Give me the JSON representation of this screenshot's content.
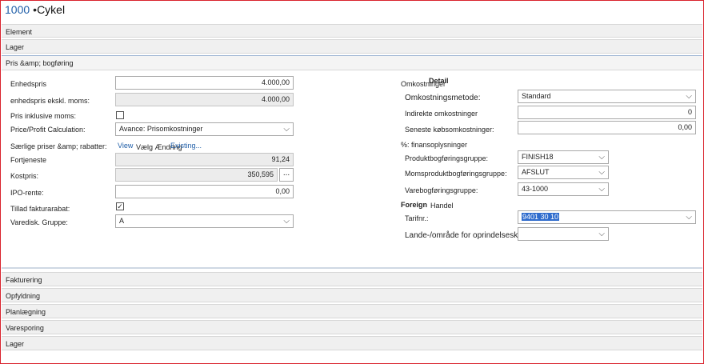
{
  "header": {
    "number": "1000",
    "separator": "•",
    "name": "Cykel"
  },
  "tabs": {
    "element": "Element",
    "lager_top": "Lager",
    "pris": "Pris &amp; bogføring",
    "fakturering": "Fakturering",
    "opfyldning": "Opfyldning",
    "planlaegning": "Planlægning",
    "varesporing": "Varesporing",
    "lager_bottom": "Lager"
  },
  "left": {
    "enhedspris": {
      "label": "Enhedspris",
      "value": "4.000,00"
    },
    "enhedspris_ekskl": {
      "label": "enhedspris ekskl. moms:",
      "value": "4.000,00"
    },
    "pris_inkl": {
      "label": "Pris inklusive moms:",
      "checked": ""
    },
    "price_profit": {
      "label": "Price/Profit Calculation:",
      "value": "Avance: Prisomkostninger"
    },
    "saerlige": {
      "label": "Særlige priser &amp; rabatter:",
      "link1": "View",
      "link2": "Vælg Ændring",
      "link3": "Existing..."
    },
    "fortjeneste": {
      "label": "Fortjeneste",
      "value": "91,24"
    },
    "kostpris": {
      "label": "Kostpris:",
      "value": "350,595",
      "button": "..."
    },
    "ipo": {
      "label": "IPO-rente:",
      "value": "0,00"
    },
    "tillad": {
      "label": "Tillad fakturarabat:",
      "checked": "✓"
    },
    "varedisk": {
      "label": "Varedisk. Gruppe:",
      "value": "A"
    }
  },
  "right": {
    "omkostninger_heading": "Omkostninger",
    "detail_heading": "Detail",
    "omk_metode": {
      "label": "Omkostningsmetode:",
      "value": "Standard"
    },
    "indirekte": {
      "label": "Indirekte omkostninger",
      "value": "0"
    },
    "seneste": {
      "label": "Seneste købsomkostninger:",
      "value": "0,00"
    },
    "finans_heading": "%: finansoplysninger",
    "produkt": {
      "label": "Produktbogføringsgruppe:",
      "value": "FINISH18"
    },
    "moms": {
      "label": "Momsproduktbogføringsgruppe:",
      "value": "AFSLUT"
    },
    "vare": {
      "label": "Varebogføringsgruppe:",
      "value": "43-1000"
    },
    "foreign_bold": "Foreign",
    "foreign_rest": "Handel",
    "tarif": {
      "label": "Tarifnr.:",
      "value": "9401 30 10"
    },
    "lande": {
      "label": "Lande-/område for oprindelseskode",
      "value": ""
    }
  },
  "icons": {
    "chevron": "chevron-down-icon",
    "check": "checkmark-icon"
  },
  "colors": {
    "accent": "#1f5ea8",
    "frame": "#d9232e",
    "selection": "#2f6ccd"
  }
}
